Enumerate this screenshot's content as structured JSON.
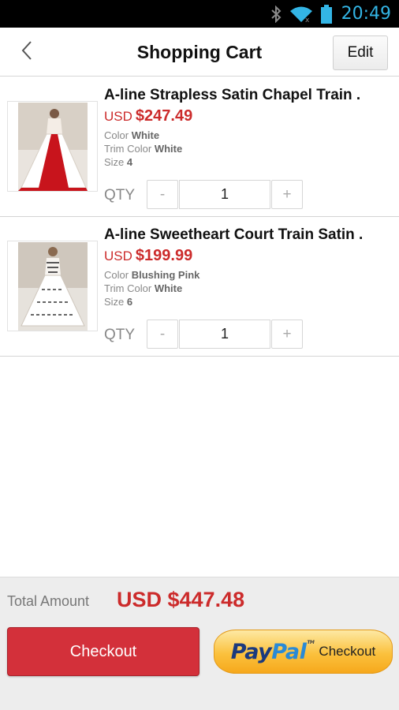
{
  "status_bar": {
    "time": "20:49"
  },
  "header": {
    "title": "Shopping Cart",
    "edit_label": "Edit"
  },
  "items": [
    {
      "name": "A-line Strapless Satin Chapel Train .",
      "currency": "USD",
      "price": "$247.49",
      "color_label": "Color",
      "color_value": "White",
      "trim_label": "Trim Color",
      "trim_value": "White",
      "size_label": "Size",
      "size_value": "4",
      "qty_label": "QTY",
      "minus": "-",
      "plus": "+",
      "qty": "1"
    },
    {
      "name": "A-line Sweetheart Court Train Satin .",
      "currency": "USD",
      "price": "$199.99",
      "color_label": "Color",
      "color_value": "Blushing Pink",
      "trim_label": "Trim Color",
      "trim_value": "White",
      "size_label": "Size",
      "size_value": "6",
      "qty_label": "QTY",
      "minus": "-",
      "plus": "+",
      "qty": "1"
    }
  ],
  "footer": {
    "total_label": "Total Amount",
    "total_value": "USD $447.48",
    "checkout_label": "Checkout",
    "paypal_pay": "Pay",
    "paypal_pal": "Pal",
    "paypal_checkout": "Checkout"
  },
  "colors": {
    "accent_red": "#cc2b2b",
    "status_time": "#33b5e5",
    "paypal_gold": "#fbc13d"
  },
  "icons": [
    "bluetooth-icon",
    "wifi-icon",
    "battery-icon",
    "back-chevron-icon",
    "dress-photo"
  ]
}
